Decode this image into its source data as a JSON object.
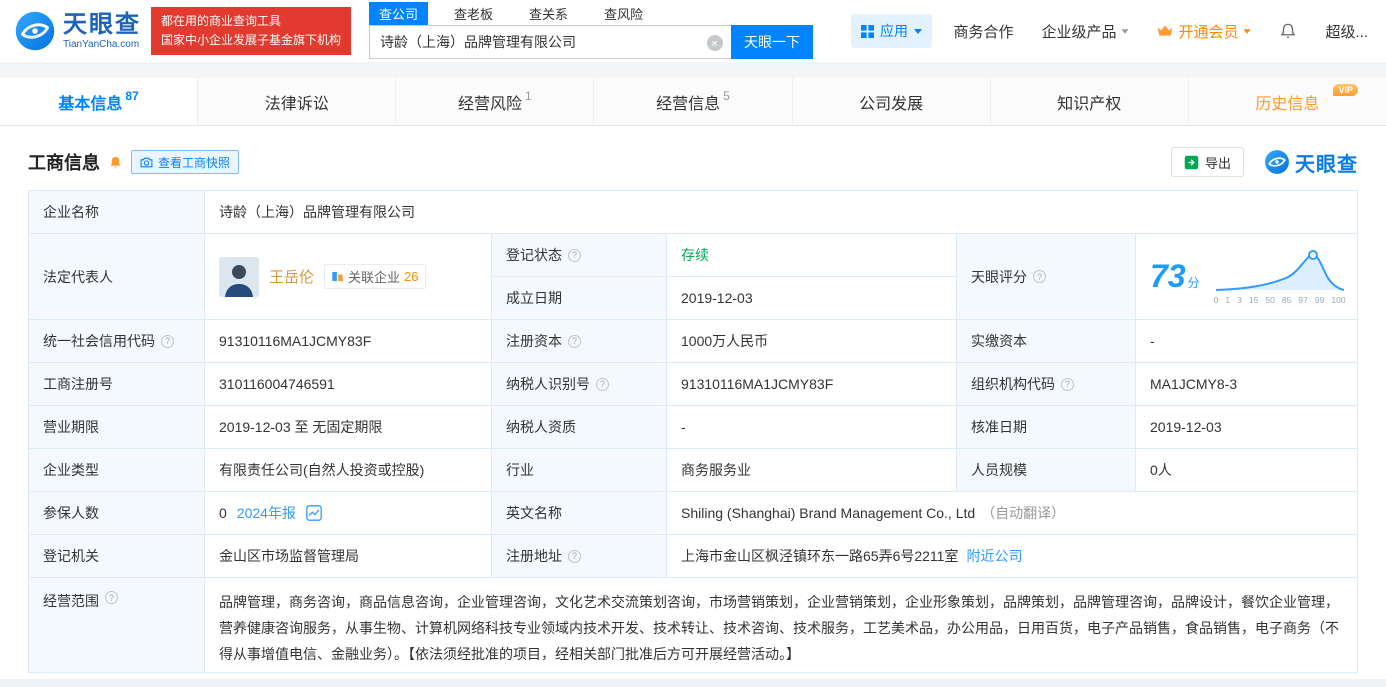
{
  "colors": {
    "accent": "#0084ff",
    "orange": "#ff9a2e",
    "green": "#00a854",
    "red_badge": "#e23a2e",
    "gold_name": "#d59a3b"
  },
  "header": {
    "brand": "天眼查",
    "brand_domain": "TianYanCha.com",
    "slogan_line1": "都在用的商业查询工具",
    "slogan_line2": "国家中小企业发展子基金旗下机构",
    "search_tabs": [
      {
        "label": "查公司"
      },
      {
        "label": "查老板"
      },
      {
        "label": "查关系"
      },
      {
        "label": "查风险"
      }
    ],
    "search_value": "诗龄（上海）品牌管理有限公司",
    "search_button": "天眼一下",
    "apps_label": "应用",
    "nav_cooperation": "商务合作",
    "nav_enterprise": "企业级产品",
    "nav_vip": "开通会员",
    "nav_super": "超级..."
  },
  "tabs": [
    {
      "label": "基本信息",
      "count": "87"
    },
    {
      "label": "法律诉讼",
      "count": ""
    },
    {
      "label": "经营风险",
      "count": "1"
    },
    {
      "label": "经营信息",
      "count": "5"
    },
    {
      "label": "公司发展",
      "count": ""
    },
    {
      "label": "知识产权",
      "count": ""
    },
    {
      "label": "历史信息",
      "count": "",
      "vip_badge": "VIP"
    }
  ],
  "section": {
    "title": "工商信息",
    "snapshot_button": "查看工商快照",
    "export_button": "导出",
    "brand": "天眼查"
  },
  "info": {
    "company_name": {
      "label": "企业名称",
      "value": "诗龄（上海）品牌管理有限公司"
    },
    "legal_rep": {
      "label": "法定代表人",
      "name": "王岳伦",
      "related_label": "关联企业",
      "related_count": "26"
    },
    "reg_status": {
      "label": "登记状态",
      "value": "存续"
    },
    "establish_date": {
      "label": "成立日期",
      "value": "2019-12-03"
    },
    "score": {
      "label": "天眼评分",
      "value": "73",
      "unit": "分",
      "axis": [
        "0",
        "1",
        "3",
        "15",
        "50",
        "85",
        "97",
        "99",
        "100"
      ]
    },
    "credit_code": {
      "label": "统一社会信用代码",
      "value": "91310116MA1JCMY83F"
    },
    "reg_capital": {
      "label": "注册资本",
      "value": "1000万人民币"
    },
    "paid_capital": {
      "label": "实缴资本",
      "value": "-"
    },
    "reg_number": {
      "label": "工商注册号",
      "value": "310116004746591"
    },
    "taxpayer_id": {
      "label": "纳税人识别号",
      "value": "91310116MA1JCMY83F"
    },
    "org_code": {
      "label": "组织机构代码",
      "value": "MA1JCMY8-3"
    },
    "business_term": {
      "label": "营业期限",
      "value": "2019-12-03 至 无固定期限"
    },
    "taxpayer_quality": {
      "label": "纳税人资质",
      "value": "-"
    },
    "approval_date": {
      "label": "核准日期",
      "value": "2019-12-03"
    },
    "company_type": {
      "label": "企业类型",
      "value": "有限责任公司(自然人投资或控股)"
    },
    "industry": {
      "label": "行业",
      "value": "商务服务业"
    },
    "staff_size": {
      "label": "人员规模",
      "value": "0人"
    },
    "insured": {
      "label": "参保人数",
      "value": "0",
      "report_link": "2024年报"
    },
    "english_name": {
      "label": "英文名称",
      "value": "Shiling (Shanghai) Brand Management Co., Ltd",
      "note": "（自动翻译）"
    },
    "reg_authority": {
      "label": "登记机关",
      "value": "金山区市场监督管理局"
    },
    "reg_address": {
      "label": "注册地址",
      "value": "上海市金山区枫泾镇环东一路65弄6号2211室",
      "nearby_link": "附近公司"
    },
    "business_scope": {
      "label": "经营范围",
      "value": "品牌管理，商务咨询，商品信息咨询，企业管理咨询，文化艺术交流策划咨询，市场营销策划，企业营销策划，企业形象策划，品牌策划，品牌管理咨询，品牌设计，餐饮企业管理，营养健康咨询服务，从事生物、计算机网络科技专业领域内技术开发、技术转让、技术咨询、技术服务，工艺美术品，办公用品，日用百货，电子产品销售，食品销售，电子商务（不得从事增值电信、金融业务）。【依法须经批准的项目，经相关部门批准后方可开展经营活动。】"
    }
  }
}
